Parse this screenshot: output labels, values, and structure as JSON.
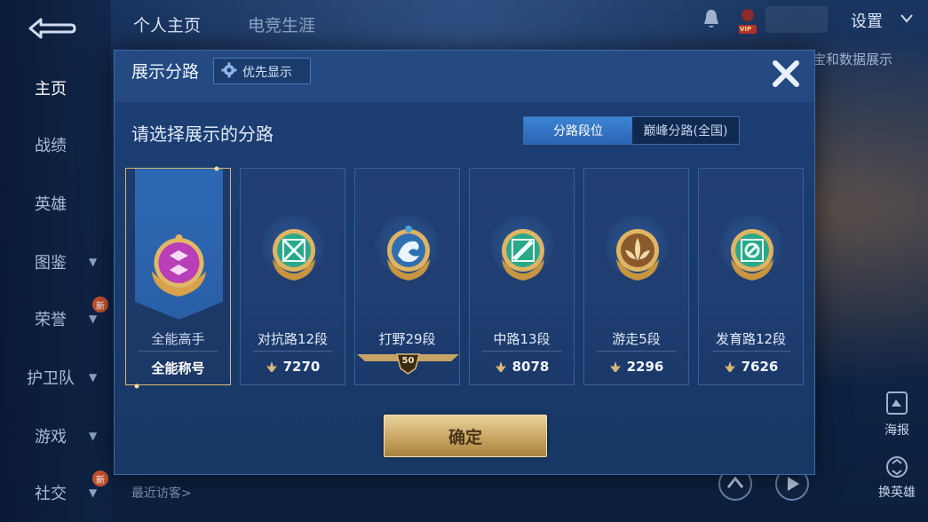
{
  "header": {
    "tabs": [
      "个人主页",
      "电竞生涯"
    ],
    "settings_label": "设置",
    "hint_text": "宝和数据展示",
    "vip_badge": "VIP"
  },
  "sidebar": {
    "items": [
      {
        "label": "主页",
        "active": true
      },
      {
        "label": "战绩"
      },
      {
        "label": "英雄"
      },
      {
        "label": "图鉴",
        "has_chevron": true
      },
      {
        "label": "荣誉",
        "has_chevron": true,
        "badge": "新"
      },
      {
        "label": "护卫队",
        "has_chevron": true
      },
      {
        "label": "游戏",
        "has_chevron": true
      },
      {
        "label": "社交",
        "has_chevron": true,
        "badge": "新"
      }
    ]
  },
  "bottom": {
    "visitors_label": "最近访客>",
    "poster_label": "海报",
    "switch_hero_label": "换英雄"
  },
  "modal": {
    "title": "展示分路",
    "priority_label": "优先显示",
    "prompt": "请选择展示的分路",
    "segments": [
      {
        "label": "分路段位",
        "active": true
      },
      {
        "label": "巅峰分路(全国)",
        "active": false
      }
    ],
    "cards": [
      {
        "name": "全能高手",
        "footer": "全能称号",
        "selected": true,
        "color": "#b83fb8"
      },
      {
        "name": "对抗路12段",
        "score": "7270",
        "color": "#2aa88a"
      },
      {
        "name": "打野29段",
        "badge": "50",
        "color": "#4aa3d6"
      },
      {
        "name": "中路13段",
        "score": "8078",
        "color": "#2aa88a"
      },
      {
        "name": "游走5段",
        "score": "2296",
        "color": "#c99a48"
      },
      {
        "name": "发育路12段",
        "score": "7626",
        "color": "#2aa88a"
      }
    ],
    "confirm_label": "确定"
  },
  "colors": {
    "accent_gold": "#d9b775",
    "segment_active": "#2a64b3"
  }
}
